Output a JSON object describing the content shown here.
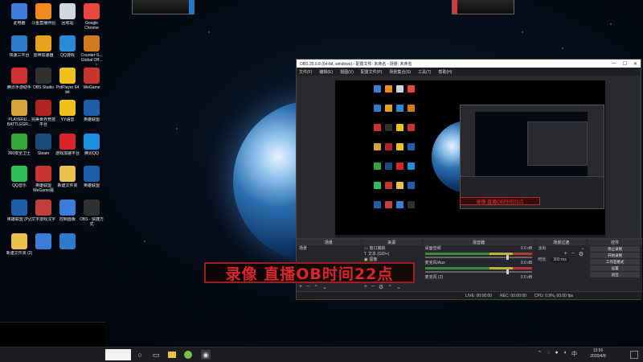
{
  "desktop": {
    "icons": [
      {
        "label": "此电脑",
        "icon": "computer-icon",
        "color": "#3b7dd8"
      },
      {
        "label": "斗鱼直播伴侣",
        "icon": "douyu-icon",
        "color": "#f08a1c"
      },
      {
        "label": "回收站",
        "icon": "recycle-bin-icon",
        "color": "#cfd6de"
      },
      {
        "label": "Google Chrome",
        "icon": "chrome-icon",
        "color": "#e8453c"
      },
      {
        "label": "快速三平台",
        "icon": "app-icon",
        "color": "#2d7ac9"
      },
      {
        "label": "雷神加速器",
        "icon": "leishen-icon",
        "color": "#e6a21a"
      },
      {
        "label": "QQ游戏",
        "icon": "qqgame-icon",
        "color": "#2a89d6"
      },
      {
        "label": "Counter-S... Global Off...",
        "icon": "csgo-icon",
        "color": "#d07a1e"
      },
      {
        "label": "腾讯手游助手",
        "icon": "tencent-mobile-icon",
        "color": "#d23131"
      },
      {
        "label": "OBS Studio",
        "icon": "obs-icon",
        "color": "#303030"
      },
      {
        "label": "PotPlayer 64 bit",
        "icon": "potplayer-icon",
        "color": "#f1c21b"
      },
      {
        "label": "WeGame",
        "icon": "wegame-icon",
        "color": "#c7362e"
      },
      {
        "label": "PLAYERU... BATTLEGR...",
        "icon": "pubg-icon",
        "color": "#d8a33a"
      },
      {
        "label": "完美世界竞技平台",
        "icon": "perfect-world-icon",
        "color": "#b22424"
      },
      {
        "label": "YY语音",
        "icon": "yy-icon",
        "color": "#f0c21c"
      },
      {
        "label": "英雄联盟",
        "icon": "lol-icon",
        "color": "#1d5fa8"
      },
      {
        "label": "360安全卫士",
        "icon": "360-icon",
        "color": "#33a83a"
      },
      {
        "label": "Steam",
        "icon": "steam-icon",
        "color": "#1a4a7a"
      },
      {
        "label": "游戏加速平台",
        "icon": "accelerator-icon",
        "color": "#d8242a"
      },
      {
        "label": "腾讯QQ",
        "icon": "qq-icon",
        "color": "#1e8fe0"
      },
      {
        "label": "QQ音乐",
        "icon": "qqmusic-icon",
        "color": "#2fbe57"
      },
      {
        "label": "英雄联盟WeGame版",
        "icon": "lol-wegame-icon",
        "color": "#c7362e"
      },
      {
        "label": "新建文件夹",
        "icon": "folder-icon",
        "color": "#e9c24a"
      },
      {
        "label": "英雄联盟",
        "icon": "lol-icon",
        "color": "#1d5fa8"
      },
      {
        "label": "英雄联盟 (Py)",
        "icon": "lol-icon",
        "color": "#1d5fa8"
      },
      {
        "label": "文字游戏汉字",
        "icon": "text-game-icon",
        "color": "#c33f3f"
      },
      {
        "label": "控制面板",
        "icon": "control-panel-icon",
        "color": "#3b7dd8"
      },
      {
        "label": "OBS - 快捷方式",
        "icon": "obs-icon",
        "color": "#303030"
      },
      {
        "label": "新建文件夹 (2)",
        "icon": "folder-icon",
        "color": "#e9c24a"
      },
      {
        "label": "",
        "icon": "app-icon",
        "color": "#3b7dd8"
      },
      {
        "label": "",
        "icon": "app-icon",
        "color": "#2d7ac9"
      }
    ],
    "banner_text": "录像 直播OB时间22点"
  },
  "obs": {
    "title": "OBS 25.0.8 (64-bit, windows) - 配置文件: 未命名 - 场景: 未命名",
    "menu": [
      "文件(F)",
      "编辑(E)",
      "视图(V)",
      "配置文件(P)",
      "场景集合(S)",
      "工具(T)",
      "帮助(H)"
    ],
    "preview_caption": "录像 直播OB时间22点",
    "docks": {
      "scenes_title": "场景",
      "scenes": [
        "场景"
      ],
      "sources_title": "来源",
      "sources": [
        "窗口捕获",
        "文本 (GDI+)",
        "图像"
      ],
      "mixer_title": "混音器",
      "mixer": [
        {
          "name": "桌面音频",
          "level": "0.0 dB"
        },
        {
          "name": "麦克风/Aux",
          "level": "0.0 dB"
        },
        {
          "name": "麦克风 (2)",
          "level": "0.0 dB"
        }
      ],
      "transitions_title": "场景过渡",
      "transition_type": "淡出",
      "duration_label": "时长",
      "duration": "300 ms",
      "controls_title": "控件",
      "controls": [
        "停止录制",
        "开始录制",
        "工作室模式",
        "设置",
        "退出"
      ]
    },
    "status": {
      "live": "LIVE: 00:00:00",
      "rec": "REC: 00:00:00",
      "cpu": "CPU: 0.9%, 60.00 fps"
    }
  },
  "taskbar": {
    "time": "13:56",
    "date": "2020/4/8"
  }
}
